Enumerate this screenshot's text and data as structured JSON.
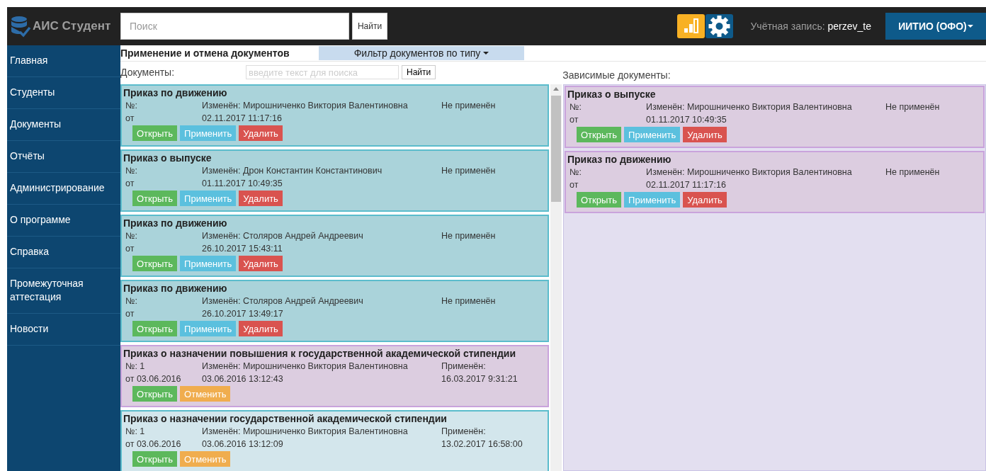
{
  "header": {
    "app_name": "АИС Студент",
    "search": {
      "placeholder": "Поиск"
    },
    "search_button": "Найти",
    "account_label": "Учётная запись:",
    "account_user": "perzev_te",
    "org_menu": "ИИТИО (ОФО)"
  },
  "sidebar": {
    "items": [
      {
        "label": "Главная"
      },
      {
        "label": "Студенты"
      },
      {
        "label": "Документы"
      },
      {
        "label": "Отчёты"
      },
      {
        "label": "Администрирование"
      },
      {
        "label": "О программе"
      },
      {
        "label": "Справка"
      },
      {
        "label": "Промежуточная аттестация"
      },
      {
        "label": "Новости"
      }
    ]
  },
  "page": {
    "title": "Применение и отмена документов",
    "filter_tab": "Фильтр документов по типу",
    "documents_label": "Документы:",
    "search": {
      "placeholder": "введите текст для поиска"
    },
    "search_button": "Найти",
    "dependent_label": "Зависимые документы:"
  },
  "documents": [
    {
      "title": "Приказ по движению",
      "number": "№:",
      "date": "от",
      "changed": "Изменён: Мирошниченко Виктория Валентиновна",
      "changed_at": "02.11.2017 11:17:16",
      "status": "Не применён",
      "color": "#aad3da",
      "buttons": [
        {
          "kind": "open",
          "label": "Открыть"
        },
        {
          "kind": "apply",
          "label": "Применить"
        },
        {
          "kind": "delete",
          "label": "Удалить"
        }
      ]
    },
    {
      "title": "Приказ о выпуске",
      "number": "№:",
      "date": "от",
      "changed": "Изменён: Дрон Константин Константинович",
      "changed_at": "01.11.2017 10:49:35",
      "status": "Не применён",
      "color": "#aad3da",
      "buttons": [
        {
          "kind": "open",
          "label": "Открыть"
        },
        {
          "kind": "apply",
          "label": "Применить"
        },
        {
          "kind": "delete",
          "label": "Удалить"
        }
      ]
    },
    {
      "title": "Приказ по движению",
      "number": "№:",
      "date": "от",
      "changed": "Изменён: Столяров Андрей Андреевич",
      "changed_at": "26.10.2017 15:43:11",
      "status": "Не применён",
      "color": "#aad3da",
      "buttons": [
        {
          "kind": "open",
          "label": "Открыть"
        },
        {
          "kind": "apply",
          "label": "Применить"
        },
        {
          "kind": "delete",
          "label": "Удалить"
        }
      ]
    },
    {
      "title": "Приказ по движению",
      "number": "№:",
      "date": "от",
      "changed": "Изменён: Столяров Андрей Андреевич",
      "changed_at": "26.10.2017 13:49:17",
      "status": "Не применён",
      "color": "#aad3da",
      "buttons": [
        {
          "kind": "open",
          "label": "Открыть"
        },
        {
          "kind": "apply",
          "label": "Применить"
        },
        {
          "kind": "delete",
          "label": "Удалить"
        }
      ]
    },
    {
      "title": "Приказ о назначении повышения к государственной академической стипендии",
      "number": "№: 1",
      "date": "от 03.06.2016",
      "changed": "Изменён: Мирошниченко Виктория Валентиновна",
      "changed_at": "03.06.2016 13:12:43",
      "status": "Применён:",
      "status_date": "16.03.2017 9:31:21",
      "color": "#dccde0",
      "buttons": [
        {
          "kind": "open",
          "label": "Открыть"
        },
        {
          "kind": "cancel",
          "label": "Отменить"
        }
      ]
    },
    {
      "title": "Приказ о назначении государственной академической стипендии",
      "number": "№: 1",
      "date": "от 03.06.2016",
      "changed": "Изменён: Мирошниченко Виктория Валентиновна",
      "changed_at": "03.06.2016 13:12:09",
      "status": "Применён:",
      "status_date": "13.02.2017 16:58:00",
      "color": "#d3e6ec",
      "buttons": [
        {
          "kind": "open",
          "label": "Открыть"
        },
        {
          "kind": "cancel",
          "label": "Отменить"
        }
      ]
    }
  ],
  "dependent_documents": [
    {
      "title": "Приказ о выпуске",
      "number": "№:",
      "date": "от",
      "changed": "Изменён: Мирошниченко Виктория Валентиновна",
      "changed_at": "01.11.2017 10:49:35",
      "status": "Не применён",
      "color": "#dccde0",
      "buttons": [
        {
          "kind": "open",
          "label": "Открыть"
        },
        {
          "kind": "apply",
          "label": "Применить"
        },
        {
          "kind": "delete",
          "label": "Удалить"
        }
      ]
    },
    {
      "title": "Приказ по движению",
      "number": "№:",
      "date": "от",
      "changed": "Изменён: Мирошниченко Виктория Валентиновна",
      "changed_at": "02.11.2017 11:17:16",
      "status": "Не применён",
      "color": "#dccde0",
      "buttons": [
        {
          "kind": "open",
          "label": "Открыть"
        },
        {
          "kind": "apply",
          "label": "Применить"
        },
        {
          "kind": "delete",
          "label": "Удалить"
        }
      ]
    }
  ]
}
